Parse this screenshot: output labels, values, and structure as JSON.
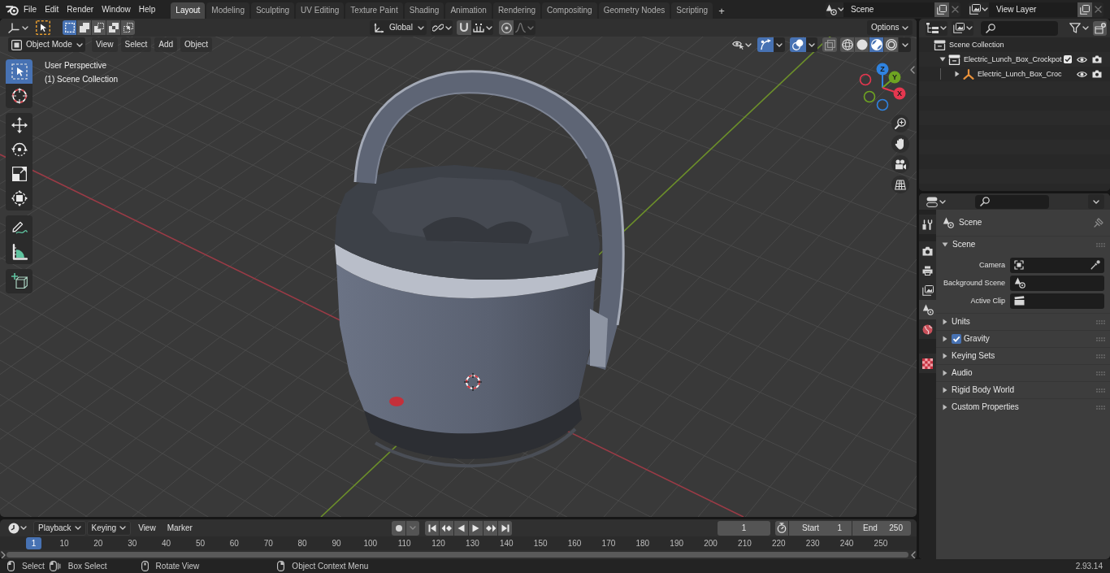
{
  "top_bar": {
    "menus": [
      "File",
      "Edit",
      "Render",
      "Window",
      "Help"
    ],
    "workspaces": [
      {
        "label": "Layout",
        "selected": true
      },
      {
        "label": "Modeling",
        "selected": false
      },
      {
        "label": "Sculpting",
        "selected": false
      },
      {
        "label": "UV Editing",
        "selected": false
      },
      {
        "label": "Texture Paint",
        "selected": false
      },
      {
        "label": "Shading",
        "selected": false
      },
      {
        "label": "Animation",
        "selected": false
      },
      {
        "label": "Rendering",
        "selected": false
      },
      {
        "label": "Compositing",
        "selected": false
      },
      {
        "label": "Geometry Nodes",
        "selected": false
      },
      {
        "label": "Scripting",
        "selected": false
      }
    ],
    "add_workspace": "+",
    "scene": "Scene",
    "view_layer": "View Layer"
  },
  "viewport": {
    "select_modes": [
      {
        "selected": true
      },
      {
        "selected": false
      },
      {
        "selected": false
      },
      {
        "selected": false
      },
      {
        "selected": false
      }
    ],
    "orientation": "Global",
    "snap": false,
    "proportional_editing": false,
    "options": "Options",
    "mode": "Object Mode",
    "menus": [
      "View",
      "Select",
      "Add",
      "Object"
    ],
    "gizmos": true,
    "overlays": true,
    "xray": false,
    "shading_modes": [
      {
        "selected": false
      },
      {
        "selected": false
      },
      {
        "selected": true
      },
      {
        "selected": false
      }
    ],
    "view_name": "User Perspective",
    "collection_label": "(1) Scene Collection",
    "tool_groups": [
      {
        "tools": [
          {
            "selected": true
          },
          {
            "selected": false
          }
        ]
      },
      {
        "tools": [
          {
            "selected": false
          },
          {
            "selected": false
          },
          {
            "selected": false
          },
          {
            "selected": false
          }
        ]
      },
      {
        "tools": [
          {
            "selected": false
          },
          {
            "selected": false
          }
        ]
      },
      {
        "tools": [
          {
            "selected": false
          }
        ]
      }
    ],
    "axes": [
      {
        "label": "Z"
      },
      {
        "label": "Y"
      },
      {
        "label": "X"
      }
    ]
  },
  "outliner": {
    "tree": [
      {
        "label": "Scene Collection",
        "kind": "scene_collection",
        "children": [
          {
            "label": "Electric_Lunch_Box_Crockpot",
            "kind": "collection",
            "expanded": true,
            "checked": true,
            "children": [
              {
                "label": "Electric_Lunch_Box_Croc",
                "kind": "object",
                "expanded": false
              }
            ]
          }
        ]
      }
    ]
  },
  "properties": {
    "tabs": [
      {
        "selected": false
      },
      {
        "selected": false
      },
      {
        "selected": false
      },
      {
        "selected": false
      },
      {
        "selected": true
      },
      {
        "selected": false
      },
      {
        "selected": false
      }
    ],
    "context": "Scene",
    "panels": [
      {
        "title": "Scene",
        "expanded": true,
        "fields": [
          {
            "label": "Camera"
          },
          {
            "label": "Background Scene"
          },
          {
            "label": "Active Clip"
          }
        ]
      },
      {
        "title": "Units",
        "expanded": false
      },
      {
        "title": "Gravity",
        "expanded": false,
        "checked": true
      },
      {
        "title": "Keying Sets",
        "expanded": false
      },
      {
        "title": "Audio",
        "expanded": false
      },
      {
        "title": "Rigid Body World",
        "expanded": false
      },
      {
        "title": "Custom Properties",
        "expanded": false
      }
    ]
  },
  "timeline": {
    "menus": [
      {
        "label": "Playback",
        "kind": "dropdown"
      },
      {
        "label": "Keying",
        "kind": "dropdown"
      },
      {
        "label": "View",
        "kind": "menu"
      },
      {
        "label": "Marker",
        "kind": "menu"
      }
    ],
    "auto_keying": false,
    "current_frame": "1",
    "start_label": "Start",
    "start": "1",
    "end_label": "End",
    "end": "250",
    "playhead": "1",
    "ruler": [
      "10",
      "20",
      "30",
      "40",
      "50",
      "60",
      "70",
      "80",
      "90",
      "100",
      "110",
      "120",
      "130",
      "140",
      "150",
      "160",
      "170",
      "180",
      "190",
      "200",
      "210",
      "220",
      "230",
      "240",
      "250"
    ]
  },
  "status_bar": {
    "hints": [
      {
        "label": "Select"
      },
      {
        "label": "Box Select"
      },
      {
        "label": "Rotate View"
      },
      {
        "label": "Object Context Menu"
      }
    ],
    "version": "2.93.14"
  }
}
